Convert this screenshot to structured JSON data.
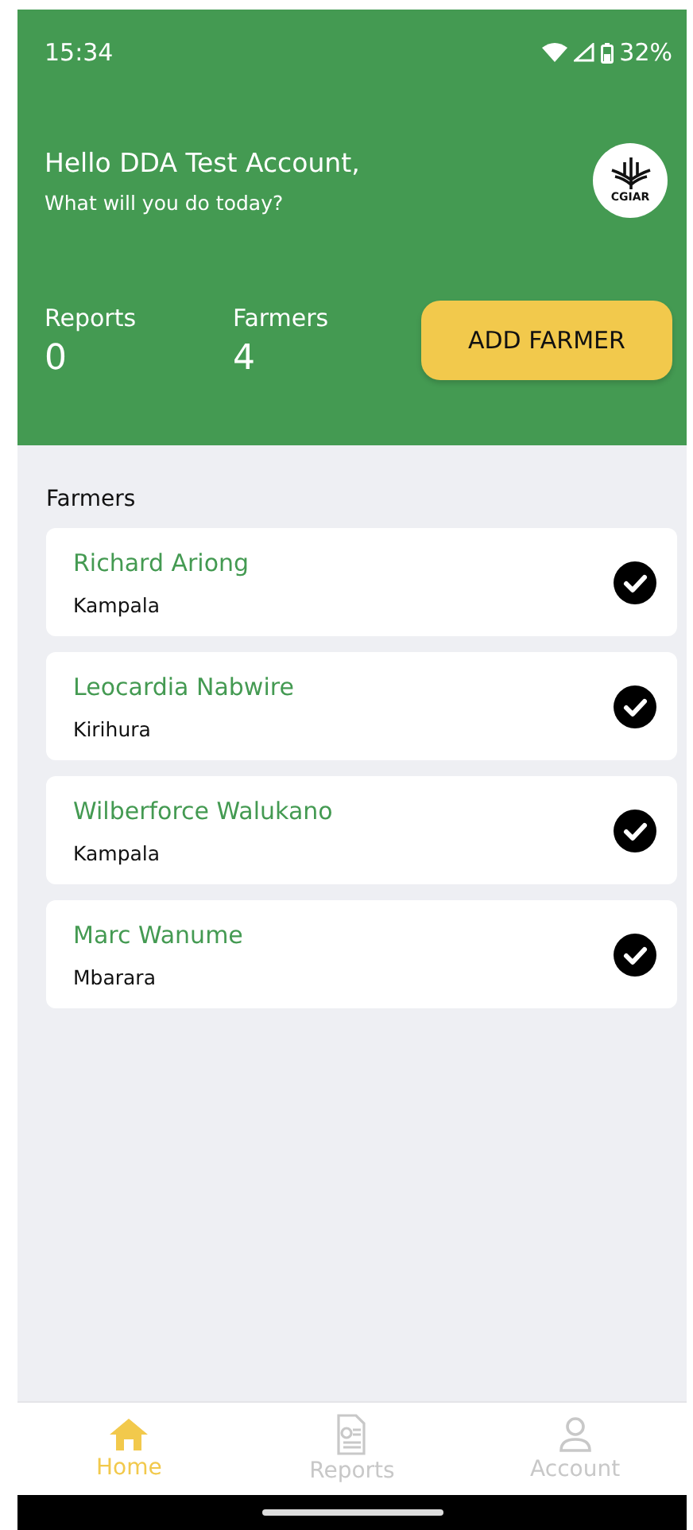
{
  "status_bar": {
    "time": "15:34",
    "battery": "32%"
  },
  "header": {
    "greeting": "Hello DDA Test Account,",
    "subtitle": "What will you do today?",
    "logo_text": "CGIAR",
    "stats": [
      {
        "label": "Reports",
        "value": "0"
      },
      {
        "label": "Farmers",
        "value": "4"
      }
    ],
    "action_button": "ADD FARMER"
  },
  "farmers_section": {
    "title": "Farmers",
    "items": [
      {
        "name": "Richard Ariong",
        "location": "Kampala",
        "verified": true
      },
      {
        "name": "Leocardia Nabwire",
        "location": "Kirihura",
        "verified": true
      },
      {
        "name": "Wilberforce Walukano",
        "location": "Kampala",
        "verified": true
      },
      {
        "name": "Marc Wanume",
        "location": "Mbarara",
        "verified": true
      }
    ]
  },
  "bottom_nav": [
    {
      "kind": "home",
      "label": "Home",
      "selected": true
    },
    {
      "kind": "reports",
      "label": "Reports",
      "selected": false
    },
    {
      "kind": "account",
      "label": "Account",
      "selected": false
    }
  ]
}
